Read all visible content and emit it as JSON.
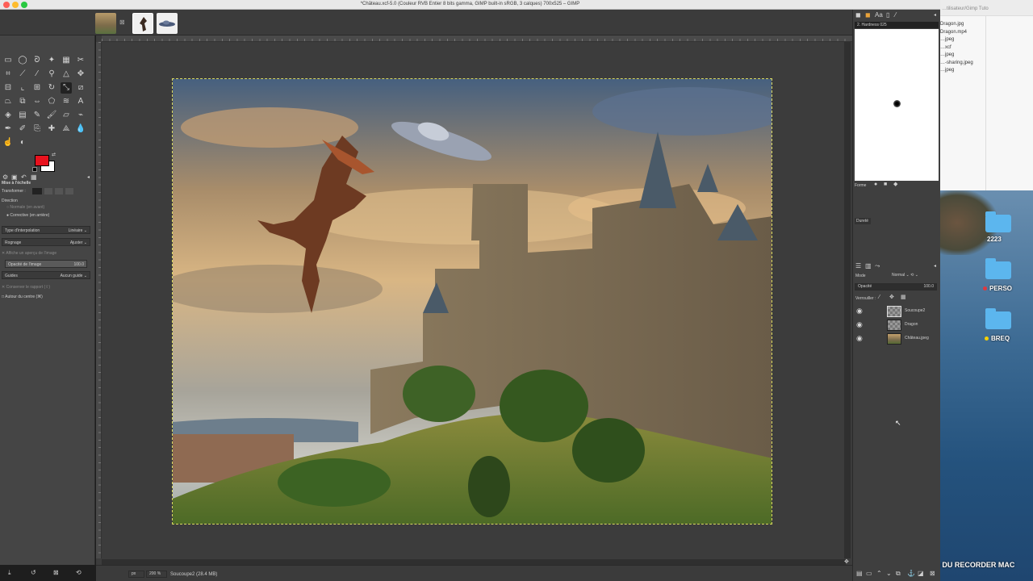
{
  "window": {
    "title": "*Château.xcf-5.0 (Couleur RVB Entier 8 bits gamma, GIMP built-in sRGB, 3 calques) 700x525 – GIMP"
  },
  "tool_options": {
    "section_title": "Mise à l'échelle",
    "transform_label": "Transformer :",
    "direction_label": "Direction",
    "direction_normal": "Normale (en avant)",
    "direction_corrective": "Corrective (en arrière)",
    "interp_label": "Type d'interpolation",
    "interp_value": "Linéaire",
    "clipping_label": "Rognage",
    "clipping_value": "Ajuster",
    "show_preview": "Affiche un aperçu de l'image",
    "opacity_label": "Opacité de l'image",
    "opacity_value": "100.0",
    "guides_label": "Guides",
    "guides_value": "Aucun guide",
    "keep_aspect": "Conserver le rapport (⇧)",
    "around_center": "Autour du centre (⌘)"
  },
  "colors": {
    "fg": "#e8121e",
    "bg": "#ffffff",
    "selection": "#d8d860"
  },
  "brushes": {
    "brush_name": "2. Hardness 025",
    "param_label_1": "Forme",
    "param_label_2": "Dureté"
  },
  "layers": {
    "mode_label": "Mode",
    "mode_value": "Normal",
    "opacity_label": "Opacité",
    "opacity_value": "100.0",
    "lock_label": "Verrouiller :",
    "items": [
      {
        "name": "Soucoupe2"
      },
      {
        "name": "Dragon"
      },
      {
        "name": "Château.jpeg"
      }
    ]
  },
  "status": {
    "unit": "px",
    "zoom": "200 %",
    "layer_info": "Soucoupe2 (28.4 MB)"
  },
  "finder": {
    "path": "…tilisateur/Gimp Tuto",
    "files": [
      "Dragon.jpg",
      "Dragon.mp4",
      "…jpeg",
      "…xcf",
      "…jpeg",
      "…-sharing.jpeg",
      "…jpeg"
    ]
  },
  "desktop": {
    "folders": [
      {
        "label": "2223",
        "tag": ""
      },
      {
        "label": "PERSO",
        "tag": "#e0383e"
      },
      {
        "label": "BREQ",
        "tag": "#f5d000"
      }
    ],
    "watermark": "DU RECORDER MAC"
  }
}
